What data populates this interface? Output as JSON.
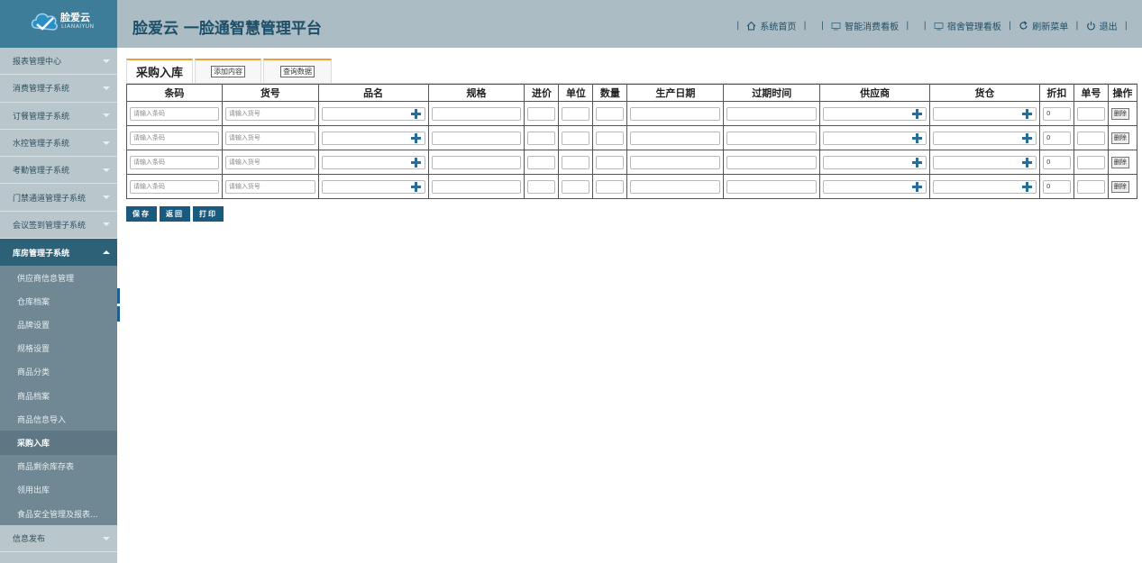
{
  "brand": {
    "name": "脸爱云",
    "sub": "LIANAIYUN"
  },
  "app_title": "脸爱云 一脸通智慧管理平台",
  "topnav": {
    "home": "系统首页",
    "consume": "智能消费看板",
    "dorm": "宿舍管理看板",
    "refresh": "刷新菜单",
    "logout": "退出"
  },
  "sidebar": {
    "items_top": [
      {
        "label": "报表管理中心"
      },
      {
        "label": "消费管理子系统"
      },
      {
        "label": "订餐管理子系统"
      },
      {
        "label": "水控管理子系统"
      },
      {
        "label": "考勤管理子系统"
      },
      {
        "label": "门禁通道管理子系统"
      },
      {
        "label": "会议签到管理子系统"
      }
    ],
    "active": {
      "label": "库房管理子系统"
    },
    "sub_items": [
      {
        "label": "供应商信息管理"
      },
      {
        "label": "仓库档案"
      },
      {
        "label": "品牌设置"
      },
      {
        "label": "规格设置"
      },
      {
        "label": "商品分类"
      },
      {
        "label": "商品档案"
      },
      {
        "label": "商品信息导入"
      },
      {
        "label": "采购入库"
      },
      {
        "label": "商品剩余库存表"
      },
      {
        "label": "领用出库"
      },
      {
        "label": "食品安全管理及报表..."
      }
    ],
    "items_bottom": [
      {
        "label": "信息发布"
      }
    ]
  },
  "tabs": {
    "main": "采购入库",
    "add": "添加内容",
    "query": "查询数据"
  },
  "table": {
    "headers": [
      "条码",
      "货号",
      "品名",
      "规格",
      "进价",
      "单位",
      "数量",
      "生产日期",
      "过期时间",
      "供应商",
      "货仓",
      "折扣",
      "单号",
      "操作"
    ],
    "barcode_placeholder": "请输入条码",
    "itemno_placeholder": "请输入货号",
    "discount_value": "0",
    "delete_label": "删除",
    "row_count": 4
  },
  "buttons": {
    "save": "保存",
    "back": "返回",
    "print": "打印"
  },
  "colors": {
    "header_bg": "#abbcc4",
    "logo_bg": "#3d7d99",
    "sidebar_bg": "#b9c7cd",
    "active_menu": "#2d6178",
    "submenu_bg": "#6f8893",
    "button_bg": "#1a5a7f",
    "tab_accent": "#e8a23a"
  }
}
